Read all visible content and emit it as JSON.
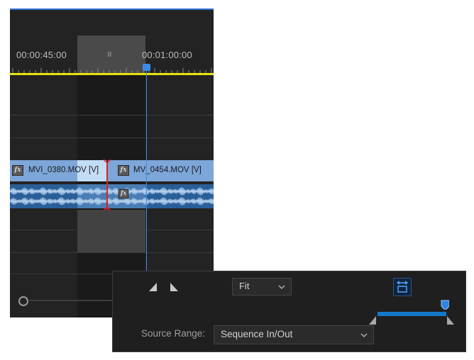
{
  "timeline": {
    "timecode_left": "00:00:45:00",
    "timecode_right": "00:01:00:00",
    "video_clip_left": "MVI_0380.MOV [V]",
    "video_clip_right": "MV_0454.MOV [V]",
    "fx_badge": "fx"
  },
  "export_panel": {
    "zoom_select": {
      "value": "Fit"
    },
    "source_range_label": "Source Range:",
    "source_range_select": {
      "value": "Sequence In/Out"
    }
  },
  "colors": {
    "playhead": "#3e8be7",
    "ruler_line": "#e7e20e",
    "edit_point": "#e02020",
    "range_track": "#1478c8"
  },
  "icons": [
    "fx-icon",
    "chevron-down-icon",
    "step-back-icon",
    "step-forward-icon",
    "fit-frame-icon",
    "playhead-marker-icon"
  ]
}
